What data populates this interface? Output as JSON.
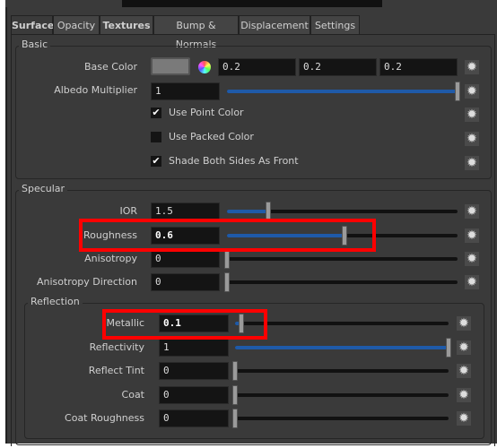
{
  "tabs": [
    {
      "label": "Surface",
      "active": true
    },
    {
      "label": "Opacity"
    },
    {
      "label": "Textures",
      "bold": true
    },
    {
      "label": "Bump & Normals"
    },
    {
      "label": "Displacement"
    },
    {
      "label": "Settings"
    }
  ],
  "basic": {
    "title": "Basic",
    "base_color": {
      "label": "Base Color",
      "values": [
        "0.2",
        "0.2",
        "0.2"
      ],
      "swatch": "#7a7a7a"
    },
    "albedo": {
      "label": "Albedo Multiplier",
      "value": "1",
      "slider": 1.0
    },
    "checkboxes": [
      {
        "label": "Use Point Color",
        "checked": true
      },
      {
        "label": "Use Packed Color",
        "checked": false
      },
      {
        "label": "Shade Both Sides As Front",
        "checked": true
      }
    ]
  },
  "specular": {
    "title": "Specular",
    "rows": [
      {
        "label": "IOR",
        "value": "1.5",
        "slider": 0.18
      },
      {
        "label": "Roughness",
        "value": "0.6",
        "slider": 0.51,
        "highlight": true
      },
      {
        "label": "Anisotropy",
        "value": "0",
        "slider": 0
      },
      {
        "label": "Anisotropy Direction",
        "value": "0",
        "slider": 0
      }
    ]
  },
  "reflection": {
    "title": "Reflection",
    "rows": [
      {
        "label": "Metallic",
        "value": "0.1",
        "slider": 0.03,
        "highlight": true
      },
      {
        "label": "Reflectivity",
        "value": "1",
        "slider": 1.0
      },
      {
        "label": "Reflect Tint",
        "value": "0",
        "slider": 0
      },
      {
        "label": "Coat",
        "value": "0",
        "slider": 0
      },
      {
        "label": "Coat Roughness",
        "value": "0",
        "slider": 0
      }
    ]
  },
  "colors": {
    "accent": "#1f5aa8",
    "highlight": "#ff0000"
  }
}
